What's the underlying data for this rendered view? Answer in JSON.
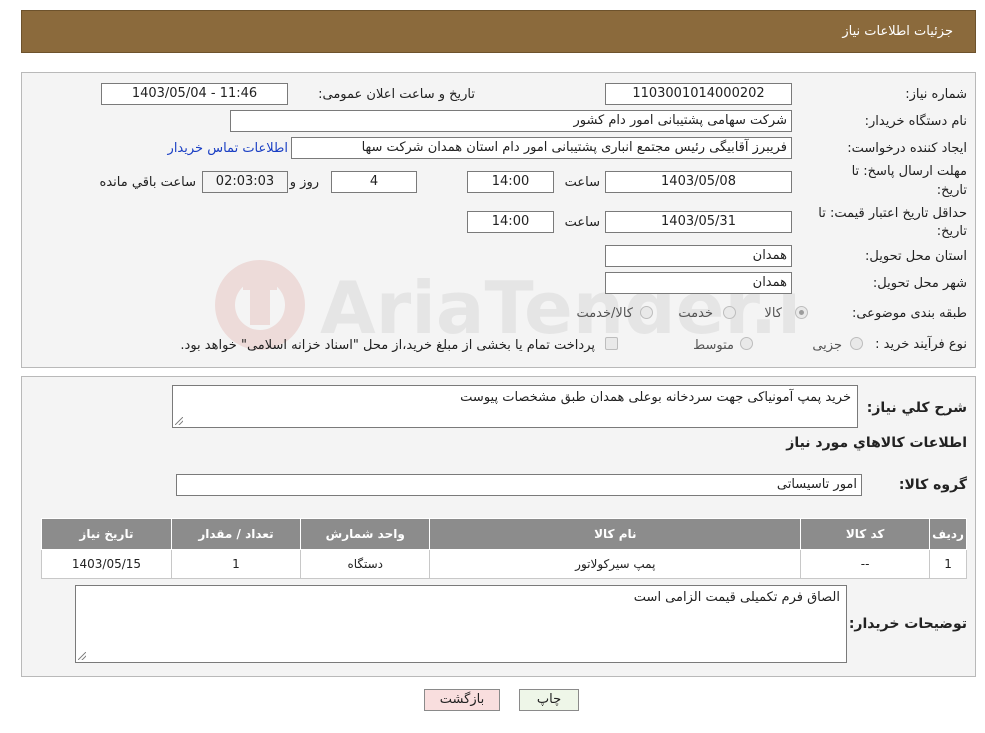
{
  "header": {
    "title": "جزئیات اطلاعات نیاز"
  },
  "fields": {
    "need_number_label": "شماره نیاز:",
    "need_number": "1103001014000202",
    "announce_label": "تاریخ و ساعت اعلان عمومی:",
    "announce_value": "1403/05/04 - 11:46",
    "buyer_org_label": "نام دستگاه خریدار:",
    "buyer_org": "شرکت سهامی پشتیبانی امور دام کشور",
    "creator_label": "ایجاد کننده درخواست:",
    "creator": "فریبرز آقابیگی رئیس مجتمع انباری پشتیبانی امور دام استان همدان شرکت سها",
    "contact_link": "اطلاعات تماس خریدار",
    "deadline_label_1": "مهلت ارسال پاسخ: تا",
    "deadline_label_2": "تاریخ:",
    "deadline_date": "1403/05/08",
    "time_label": "ساعت",
    "deadline_time": "14:00",
    "days": "4",
    "days_label": "روز و",
    "remaining": "02:03:03",
    "remaining_label": "ساعت باقي مانده",
    "validity_label_1": "حداقل تاریخ اعتبار قیمت: تا",
    "validity_label_2": "تاریخ:",
    "validity_date": "1403/05/31",
    "validity_time": "14:00",
    "province_label": "استان محل تحویل:",
    "province": "همدان",
    "city_label": "شهر محل تحویل:",
    "city": "همدان",
    "category_label": "طبقه بندی موضوعی:",
    "category_options": [
      "کالا",
      "خدمت",
      "کالا/خدمت"
    ],
    "process_label": "نوع فرآیند خرید :",
    "process_options": [
      "جزیی",
      "متوسط"
    ],
    "process_note": "پرداخت تمام یا بخشی از مبلغ خرید،از محل \"اسناد خزانه اسلامی\" خواهد بود."
  },
  "summary": {
    "label": "شرح کلي نياز:",
    "value": "خرید پمپ آمونیاکی جهت سردخانه بوعلی همدان طبق مشخصات پیوست",
    "goods_title": "اطلاعات کالاهاي مورد نياز",
    "group_label": "گروه کالا:",
    "group_value": "امور تاسیساتی"
  },
  "table": {
    "headers": [
      "رديف",
      "کد کالا",
      "نام کالا",
      "واحد شمارش",
      "تعداد / مقدار",
      "تاريخ نياز"
    ],
    "rows": [
      [
        "1",
        "--",
        "پمپ سیرکولاتور",
        "دستگاه",
        "1",
        "1403/05/15"
      ]
    ]
  },
  "buyer_notes": {
    "label": "توضیحات خریدار:",
    "value": "الصاق فرم تکمیلی قیمت الزامی است"
  },
  "buttons": {
    "print": "چاپ",
    "back": "بازگشت"
  },
  "colors": {
    "header_bg": "#8b6a3c",
    "table_header_bg": "#8c8c8c",
    "back_button_bg": "#f9dede",
    "print_button_bg": "#eef6e8"
  },
  "watermark": {
    "text": "AriaTender.neT"
  }
}
